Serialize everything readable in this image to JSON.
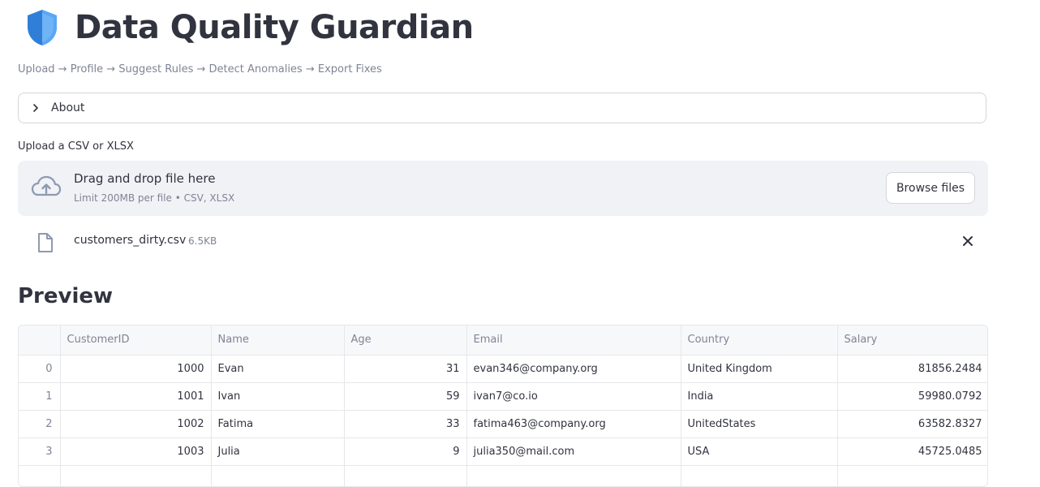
{
  "app": {
    "title": "Data Quality Guardian",
    "title_icon": "shield-icon",
    "pipeline": "Upload → Profile → Suggest Rules → Detect Anomalies → Export Fixes"
  },
  "about": {
    "label": "About",
    "icon": "chevron-right-icon"
  },
  "uploader": {
    "label": "Upload a CSV or XLSX",
    "drop_title": "Drag and drop file here",
    "drop_sub": "Limit 200MB per file • CSV, XLSX",
    "browse_label": "Browse files",
    "icon": "cloud-upload-icon",
    "file": {
      "name": "customers_dirty.csv",
      "size": "6.5KB",
      "icon": "file-icon",
      "remove_icon": "close-icon"
    }
  },
  "preview": {
    "heading": "Preview",
    "columns": [
      "",
      "CustomerID",
      "Name",
      "Age",
      "Email",
      "Country",
      "Salary"
    ],
    "rows": [
      [
        "0",
        "1000",
        "Evan",
        "31",
        "evan346@company.org",
        "United Kingdom",
        "81856.2484"
      ],
      [
        "1",
        "1001",
        "Ivan",
        "59",
        "ivan7@co.io",
        "India",
        "59980.0792"
      ],
      [
        "2",
        "1002",
        "Fatima",
        "33",
        "fatima463@company.org",
        "UnitedStates",
        "63582.8327"
      ],
      [
        "3",
        "1003",
        "Julia",
        "9",
        "julia350@mail.com",
        "USA",
        "45725.0485"
      ],
      [
        "",
        "",
        "",
        "",
        "",
        "",
        ""
      ]
    ]
  },
  "colors": {
    "text": "#31333f",
    "muted": "#808495",
    "dropzone_bg": "#f0f2f6",
    "shield_blue": "#3b8ee8"
  }
}
